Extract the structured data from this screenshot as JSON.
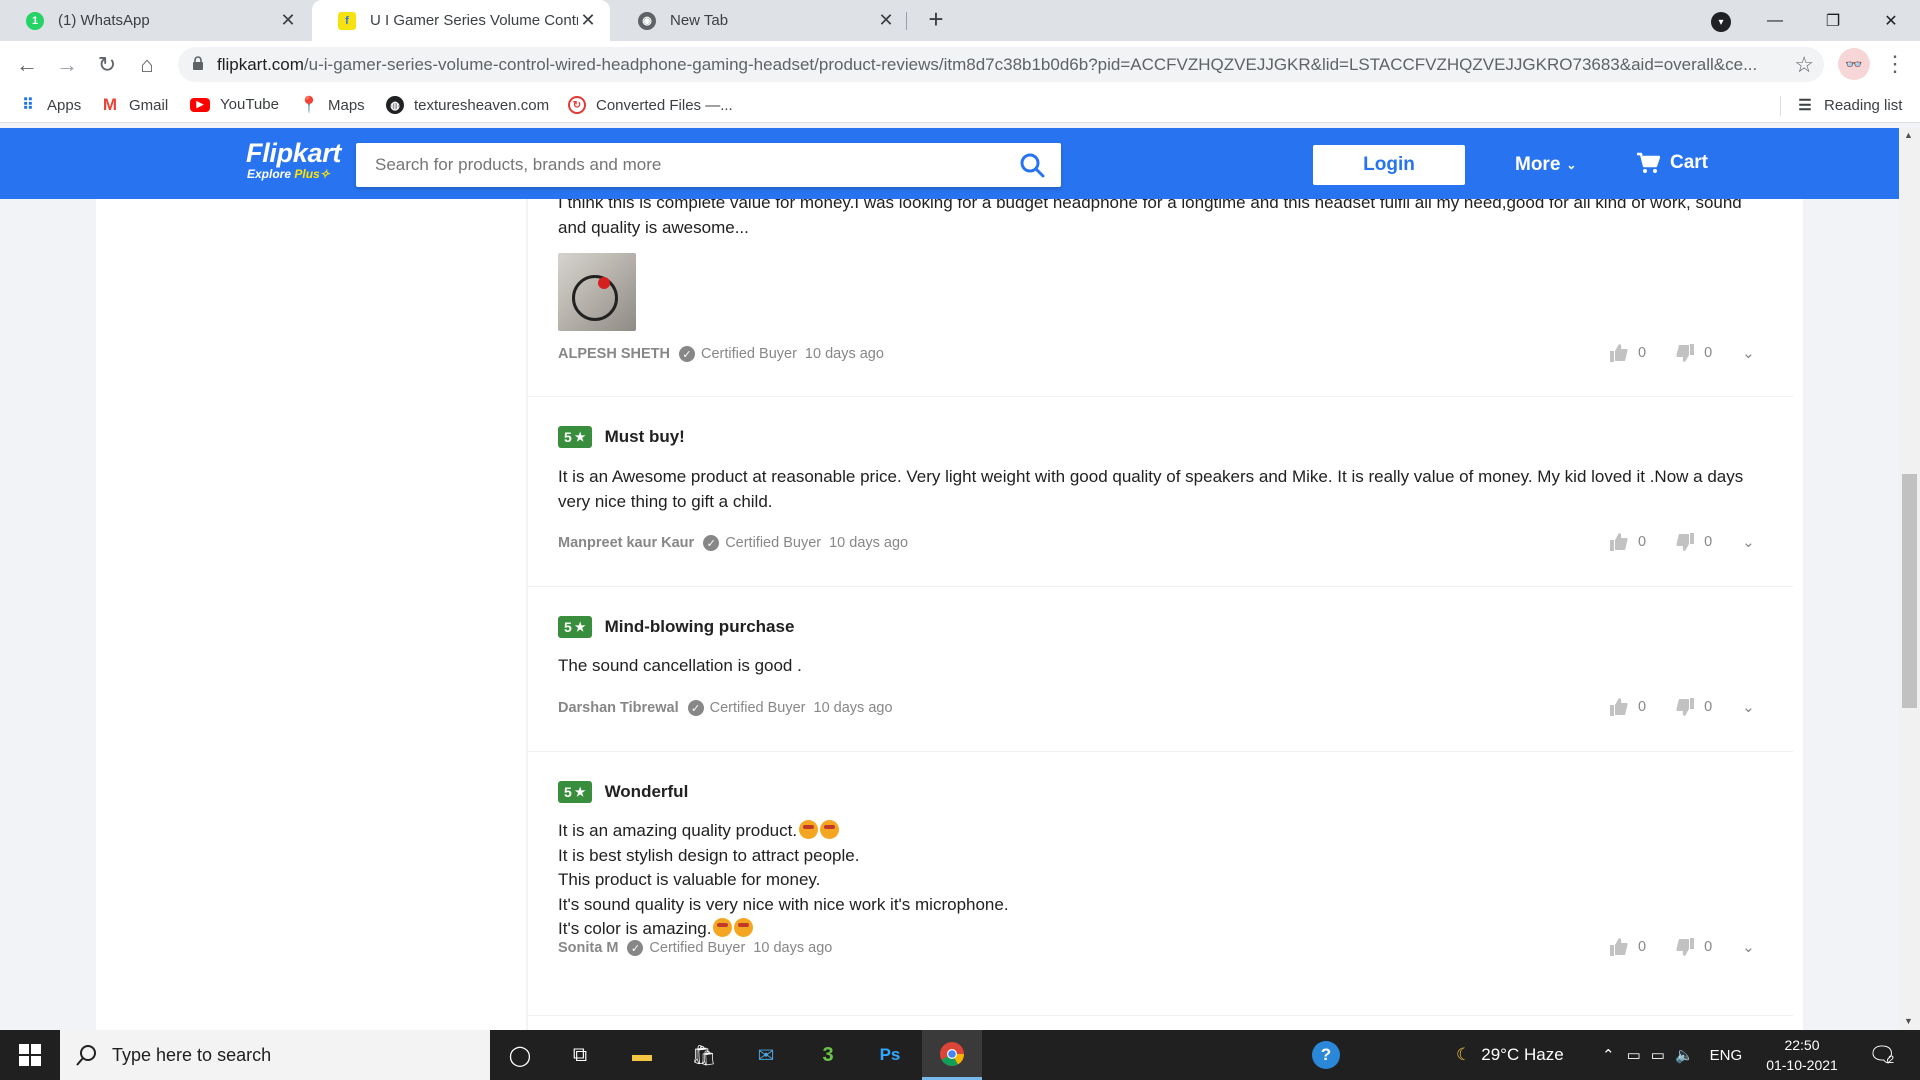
{
  "browser": {
    "tabs": [
      {
        "title": "(1) WhatsApp",
        "favicon": "whatsapp-icon",
        "active": false
      },
      {
        "title": "U I Gamer Series Volume Control",
        "favicon": "flipkart-icon",
        "active": true
      },
      {
        "title": "New Tab",
        "favicon": "chrome-icon",
        "active": false
      }
    ],
    "url_domain": "flipkart.com",
    "url_path": "/u-i-gamer-series-volume-control-wired-headphone-gaming-headset/product-reviews/itm8d7c38b1b0d6b?pid=ACCFVZHQZVEJJGKR&lid=LSTACCFVZHQZVEJJGKRO73683&aid=overall&ce...",
    "bookmarks": [
      {
        "label": "Apps",
        "icon": "apps-grid-icon"
      },
      {
        "label": "Gmail",
        "icon": "gmail-icon"
      },
      {
        "label": "YouTube",
        "icon": "youtube-icon"
      },
      {
        "label": "Maps",
        "icon": "maps-icon"
      },
      {
        "label": "texturesheaven.com",
        "icon": "globe-icon"
      },
      {
        "label": "Converted Files —...",
        "icon": "converter-icon"
      }
    ],
    "reading_list": "Reading list"
  },
  "flipkart": {
    "logo": "Flipkart",
    "logo_sub": "Explore",
    "logo_plus": "Plus",
    "search_placeholder": "Search for products, brands and more",
    "login": "Login",
    "more": "More",
    "cart": "Cart",
    "colors": {
      "primary": "#2874f0",
      "rating_green": "#388e3c",
      "plus_yellow": "#ffe500"
    }
  },
  "reviews": [
    {
      "partial": true,
      "lines": [
        "I think this is complete value for money.I was looking for a budget headphone for a longtime and this headset fulfil all my need,good for all kind of work, sound",
        "and quality is awesome..."
      ],
      "author": "ALPESH SHETH",
      "badge": "Certified Buyer",
      "date": "10 days ago",
      "likes": "0",
      "dislikes": "0"
    },
    {
      "rating": "5",
      "title": "Must buy!",
      "lines": [
        "It is an Awesome product at reasonable price. Very light weight with good quality of speakers and Mike. It is really value of money. My kid loved it .Now a days",
        "very nice thing to gift a child."
      ],
      "author": "Manpreet kaur Kaur",
      "badge": "Certified Buyer",
      "date": "10 days ago",
      "likes": "0",
      "dislikes": "0"
    },
    {
      "rating": "5",
      "title": "Mind-blowing purchase",
      "lines": [
        "The sound cancellation is good ."
      ],
      "author": "Darshan Tibrewal",
      "badge": "Certified Buyer",
      "date": "10 days ago",
      "likes": "0",
      "dislikes": "0"
    },
    {
      "rating": "5",
      "title": "Wonderful",
      "lines": [
        "It is an amazing quality product.",
        "It is best stylish design to attract people.",
        "This product is valuable for money.",
        "It's sound quality is very nice with nice work it's microphone.",
        "It's color is amazing."
      ],
      "author": "Sonita M",
      "badge": "Certified Buyer",
      "date": "10 days ago",
      "likes": "0",
      "dislikes": "0"
    }
  ],
  "taskbar": {
    "search_placeholder": "Type here to search",
    "weather": "29°C  Haze",
    "language": "ENG",
    "time": "22:50",
    "date": "01-10-2021",
    "notifications": "2"
  }
}
